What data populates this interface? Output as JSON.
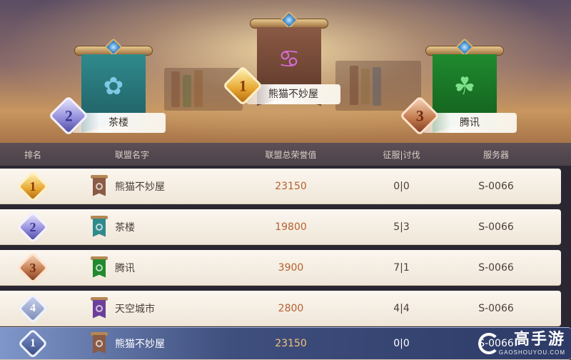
{
  "podium": {
    "first": {
      "rank": "1",
      "name": "熊猫不妙屋",
      "banner_color": "#8a5a45",
      "emblem": "♋"
    },
    "second": {
      "rank": "2",
      "name": "茶楼",
      "banner_color": "#2f8a8c",
      "emblem": "✿"
    },
    "third": {
      "rank": "3",
      "name": "腾讯",
      "banner_color": "#1f8a2e",
      "emblem": "☘"
    }
  },
  "table": {
    "headers": {
      "rank": "排名",
      "name": "联盟名字",
      "score": "联盟总荣誉值",
      "conquest": "征服|讨伐",
      "server": "服务器"
    },
    "rows": [
      {
        "rank": "1",
        "badge": "gold",
        "flag_color": "#8a5a45",
        "name": "熊猫不妙屋",
        "score": "23150",
        "conquest": "0|0",
        "server": "S-0066"
      },
      {
        "rank": "2",
        "badge": "silver",
        "flag_color": "#2f8a8c",
        "name": "茶楼",
        "score": "19800",
        "conquest": "5|3",
        "server": "S-0066"
      },
      {
        "rank": "3",
        "badge": "bronze",
        "flag_color": "#1f8a2e",
        "name": "腾讯",
        "score": "3900",
        "conquest": "7|1",
        "server": "S-0066"
      },
      {
        "rank": "4",
        "badge": "plain",
        "flag_color": "#6b3f9a",
        "name": "天空城市",
        "score": "2800",
        "conquest": "4|4",
        "server": "S-0066"
      }
    ],
    "mine": {
      "rank": "1",
      "flag_color": "#8a5a45",
      "name": "熊猫不妙屋",
      "score": "23150",
      "conquest": "0|0",
      "server": "S-0066"
    }
  },
  "watermark": {
    "title": "高手游",
    "url": "GAOSHOUYOU.COM"
  }
}
